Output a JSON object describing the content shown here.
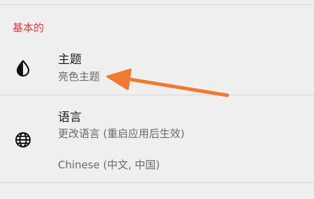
{
  "section": {
    "header": "基本的",
    "header_color": "#d9383d"
  },
  "theme_row": {
    "title": "主题",
    "subtitle": "亮色主题",
    "icon": "contrast-icon"
  },
  "language_row": {
    "title": "语言",
    "subtitle": "更改语言 (重启应用后生效)",
    "value": "Chinese (中文, 中国)",
    "icon": "globe-icon"
  },
  "annotation": {
    "arrow_color": "#f07a2f"
  }
}
